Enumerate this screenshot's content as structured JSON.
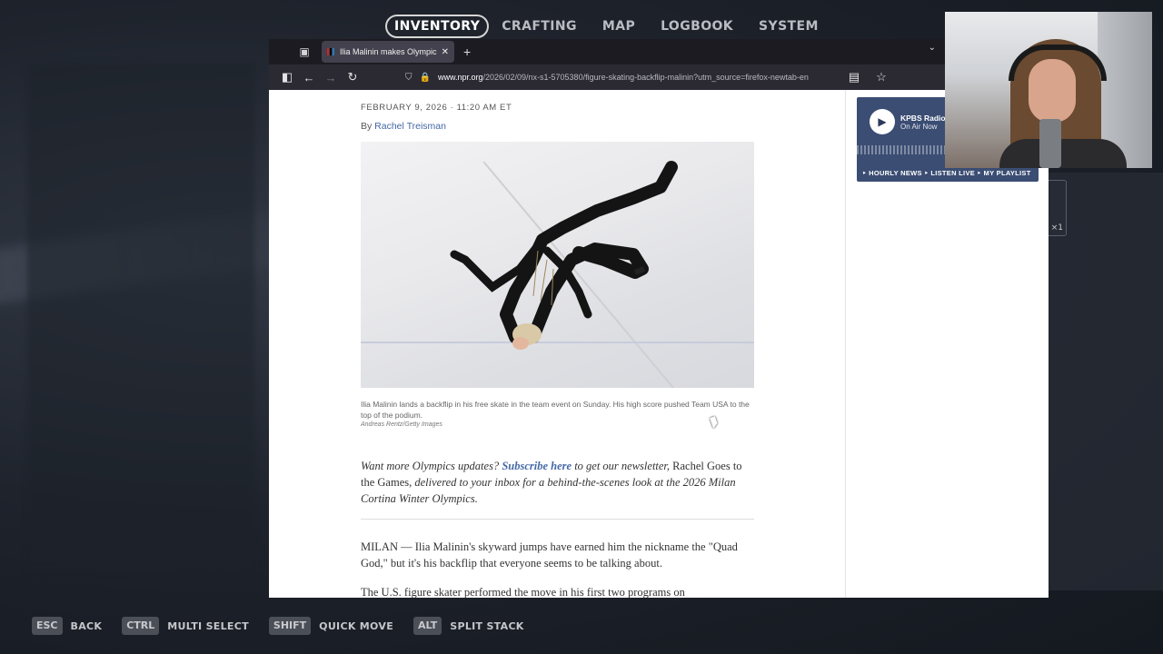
{
  "game": {
    "nav_tabs": [
      {
        "label": "INVENTORY",
        "active": true
      },
      {
        "label": "CRAFTING",
        "active": false
      },
      {
        "label": "MAP",
        "active": false
      },
      {
        "label": "LOGBOOK",
        "active": false
      },
      {
        "label": "SYSTEM",
        "active": false
      }
    ],
    "slot_count": "×1",
    "key_hints": [
      {
        "key": "ESC",
        "label": "BACK"
      },
      {
        "key": "CTRL",
        "label": "MULTI SELECT"
      },
      {
        "key": "SHIFT",
        "label": "QUICK MOVE"
      },
      {
        "key": "ALT",
        "label": "SPLIT STACK"
      }
    ]
  },
  "browser": {
    "tab_title": "Ilia Malinin makes Olympic back",
    "url_host": "www.npr.org",
    "url_path": "/2026/02/09/nx-s1-5705380/figure-skating-backflip-malinin?utm_source=firefox-newtab-en",
    "icons": {
      "shield": "shield-icon",
      "lock": "lock-icon"
    }
  },
  "article": {
    "dateline": "FEBRUARY 9, 2026 · 11:20 AM ET",
    "byline_prefix": "By ",
    "author": "Rachel Treisman",
    "caption": "Ilia Malinin lands a backflip in his free skate in the team event on Sunday. His high score pushed Team USA to the top of the podium.",
    "credit": "Andreas Rentz/Getty Images",
    "promo": {
      "lead": "Want more Olympics updates? ",
      "link": "Subscribe here",
      "mid": " to get our newsletter, ",
      "plain": "Rachel Goes to the Games, ",
      "tail": "delivered to your inbox for a behind-the-scenes look at the 2026 Milan Cortina Winter Olympics."
    },
    "para1": "MILAN — Ilia Malinin's skyward jumps have earned him the nickname the \"Quad God,\" but it's his backflip that everyone seems to be talking about.",
    "para2": "The U.S. figure skater performed the move in his first two programs on"
  },
  "radio": {
    "station": "KPBS Radio",
    "status": "On Air Now",
    "links": "‣ HOURLY NEWS  ‣ LISTEN LIVE  ‣ MY PLAYLIST"
  },
  "colors": {
    "link": "#4468a6",
    "radio_bg": "#3b4d73",
    "tab_bar": "#1c1b22"
  }
}
